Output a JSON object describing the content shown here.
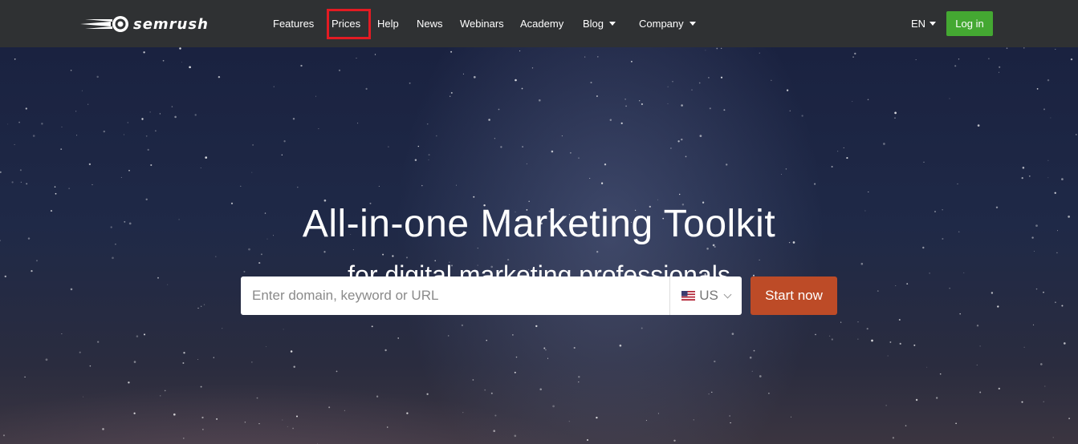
{
  "brand": {
    "name": "semrush",
    "logo_icon": "fireball-icon"
  },
  "nav": {
    "items": [
      {
        "label": "Features"
      },
      {
        "label": "Prices"
      },
      {
        "label": "Help"
      },
      {
        "label": "News"
      },
      {
        "label": "Webinars"
      },
      {
        "label": "Academy"
      },
      {
        "label": "Blog"
      },
      {
        "label": "Company"
      }
    ],
    "language": "EN",
    "login_label": "Log in",
    "highlighted_item": "Prices"
  },
  "hero": {
    "headline": "All-in-one Marketing Toolkit",
    "subheadline": "for digital marketing professionals",
    "search": {
      "placeholder": "Enter domain, keyword or URL",
      "value": "",
      "database": "US",
      "database_icon": "us-flag-icon"
    },
    "cta_label": "Start now"
  },
  "colors": {
    "navbar": "#2f3133",
    "login": "#44a832",
    "cta": "#bd4b27",
    "highlight": "#e31b23"
  }
}
